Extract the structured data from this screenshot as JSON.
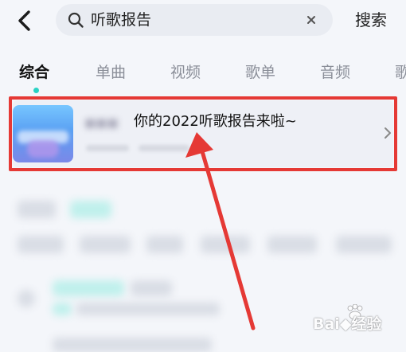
{
  "header": {
    "back_icon": "chevron-left-icon",
    "search": {
      "query": "听歌报告",
      "icon": "search-icon",
      "clear_icon": "close-icon"
    },
    "search_button_label": "搜索"
  },
  "tabs": [
    {
      "label": "综合",
      "active": true
    },
    {
      "label": "单曲",
      "active": false
    },
    {
      "label": "视频",
      "active": false
    },
    {
      "label": "歌单",
      "active": false
    },
    {
      "label": "音频",
      "active": false
    },
    {
      "label": "歌",
      "active": false
    }
  ],
  "result": {
    "title": "你的2022听歌报告来啦~",
    "chevron_icon": "chevron-right-icon"
  },
  "colors": {
    "accent": "#2ad2c4",
    "highlight": "#e53935",
    "background": "#f4f6fa"
  }
}
